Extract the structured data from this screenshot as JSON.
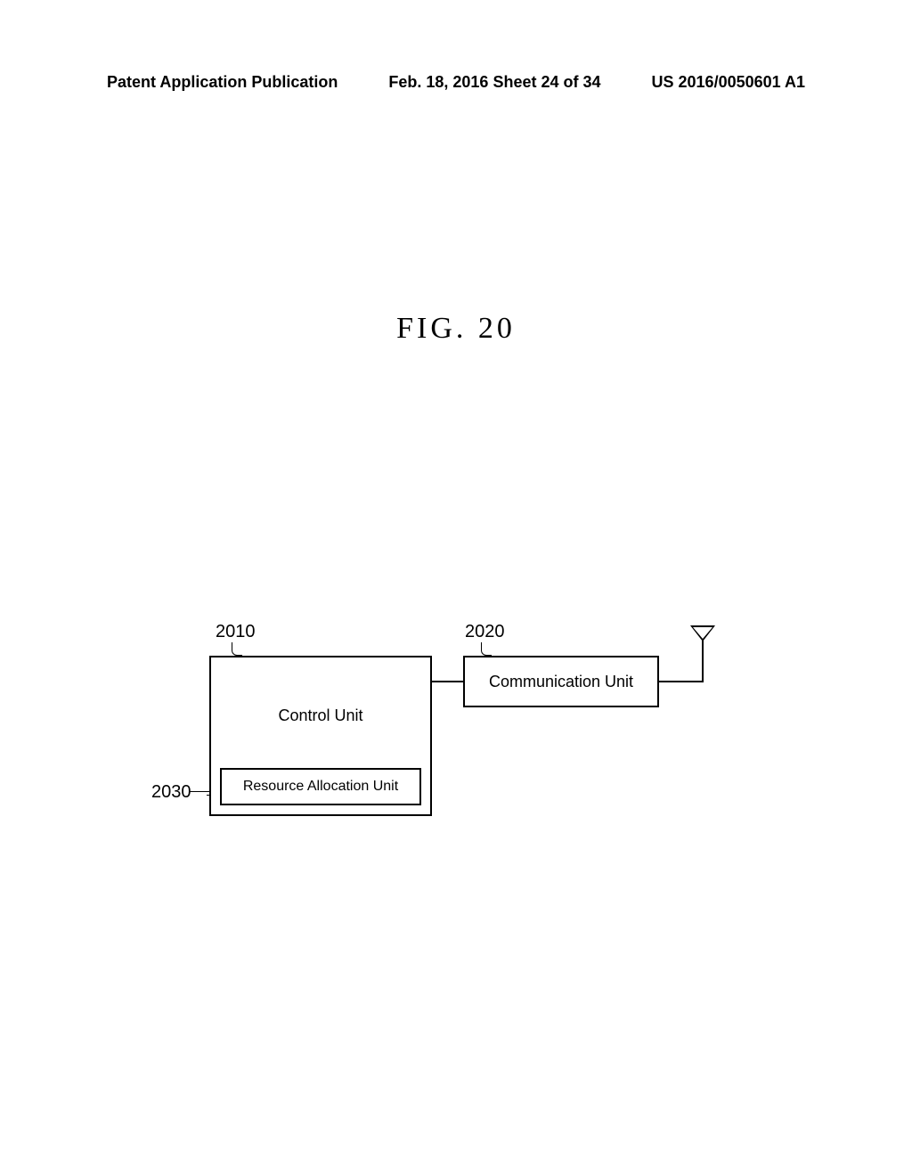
{
  "header": {
    "left": "Patent Application Publication",
    "center": "Feb. 18, 2016  Sheet 24 of 34",
    "right": "US 2016/0050601 A1"
  },
  "figure_title": "FIG. 20",
  "diagram": {
    "ref_2010": "2010",
    "ref_2020": "2020",
    "ref_2030": "2030",
    "control_unit_label": "Control Unit",
    "resource_allocation_label": "Resource Allocation Unit",
    "communication_unit_label": "Communication Unit"
  }
}
